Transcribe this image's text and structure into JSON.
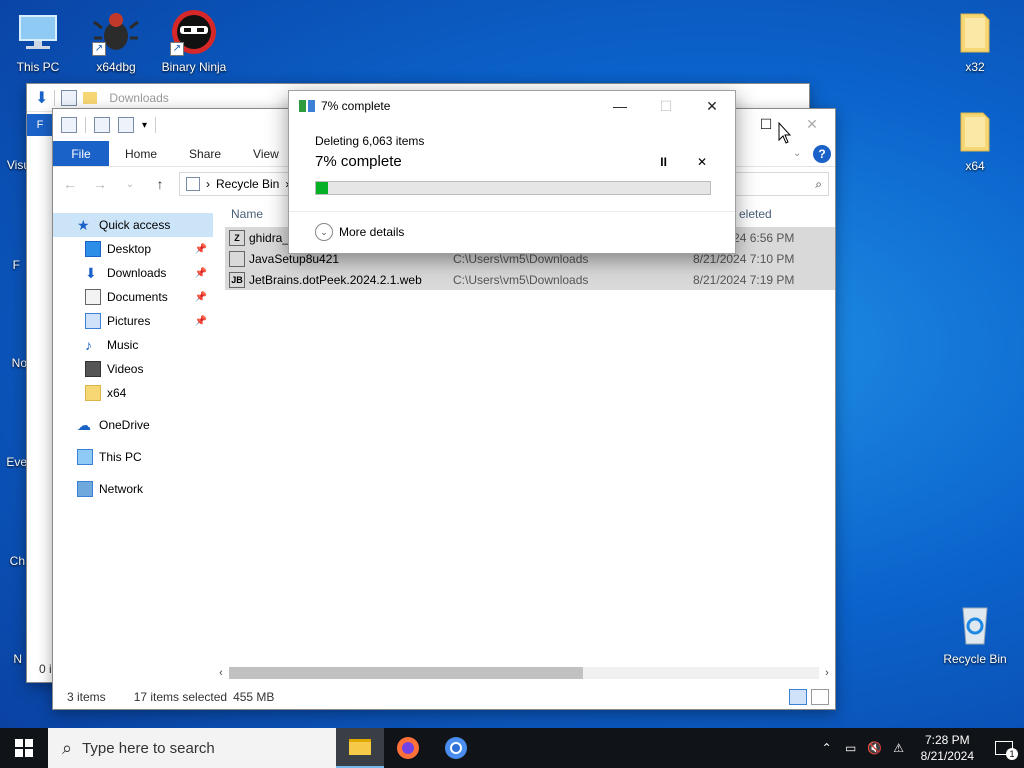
{
  "desktop": {
    "icons": [
      {
        "label": "This PC",
        "icon": "monitor-icon"
      },
      {
        "label": "x64dbg",
        "icon": "bug-icon"
      },
      {
        "label": "Binary Ninja",
        "icon": "ninja-icon"
      },
      {
        "label": "x32",
        "icon": "folder-icon"
      },
      {
        "label": "x64",
        "icon": "folder-icon"
      },
      {
        "label": "Recycle Bin",
        "icon": "recycle-bin-icon"
      }
    ],
    "partial_labels": [
      "Visu",
      "F",
      "No",
      "Eve",
      "Ch",
      "N"
    ]
  },
  "back_window": {
    "title": "Downloads",
    "file_tab": "F",
    "status": "0 i"
  },
  "explorer": {
    "ribbon_tabs": [
      "File",
      "Home",
      "Share",
      "View"
    ],
    "address": "Recycle Bin",
    "columns": {
      "name": "Name",
      "date": "eleted"
    },
    "nav": {
      "quick_access": "Quick access",
      "items": [
        {
          "label": "Desktop",
          "pinned": true
        },
        {
          "label": "Downloads",
          "pinned": true
        },
        {
          "label": "Documents",
          "pinned": true
        },
        {
          "label": "Pictures",
          "pinned": true
        },
        {
          "label": "Music",
          "pinned": false
        },
        {
          "label": "Videos",
          "pinned": false
        },
        {
          "label": "x64",
          "pinned": false
        }
      ],
      "onedrive": "OneDrive",
      "this_pc": "This PC",
      "network": "Network"
    },
    "files": [
      {
        "name": "ghidra_",
        "location": "",
        "date": "8/21/2024 6:56 PM",
        "badge": "Z"
      },
      {
        "name": "JavaSetup8u421",
        "location": "C:\\Users\\vm5\\Downloads",
        "date": "8/21/2024 7:10 PM",
        "badge": ""
      },
      {
        "name": "JetBrains.dotPeek.2024.2.1.web",
        "location": "C:\\Users\\vm5\\Downloads",
        "date": "8/21/2024 7:19 PM",
        "badge": "JB"
      }
    ],
    "status": {
      "items": "3 items",
      "selected": "17 items selected",
      "size": "455 MB"
    },
    "scroll_fraction": 0.6
  },
  "dialog": {
    "title": "7% complete",
    "subtitle": "Deleting 6,063 items",
    "percent_text": "7% complete",
    "progress": 0.03,
    "pause_glyph": "II",
    "cancel_glyph": "✕",
    "more_details": "More details"
  },
  "taskbar": {
    "search_placeholder": "Type here to search",
    "time": "7:28 PM",
    "date": "8/21/2024",
    "notification_count": "1"
  }
}
